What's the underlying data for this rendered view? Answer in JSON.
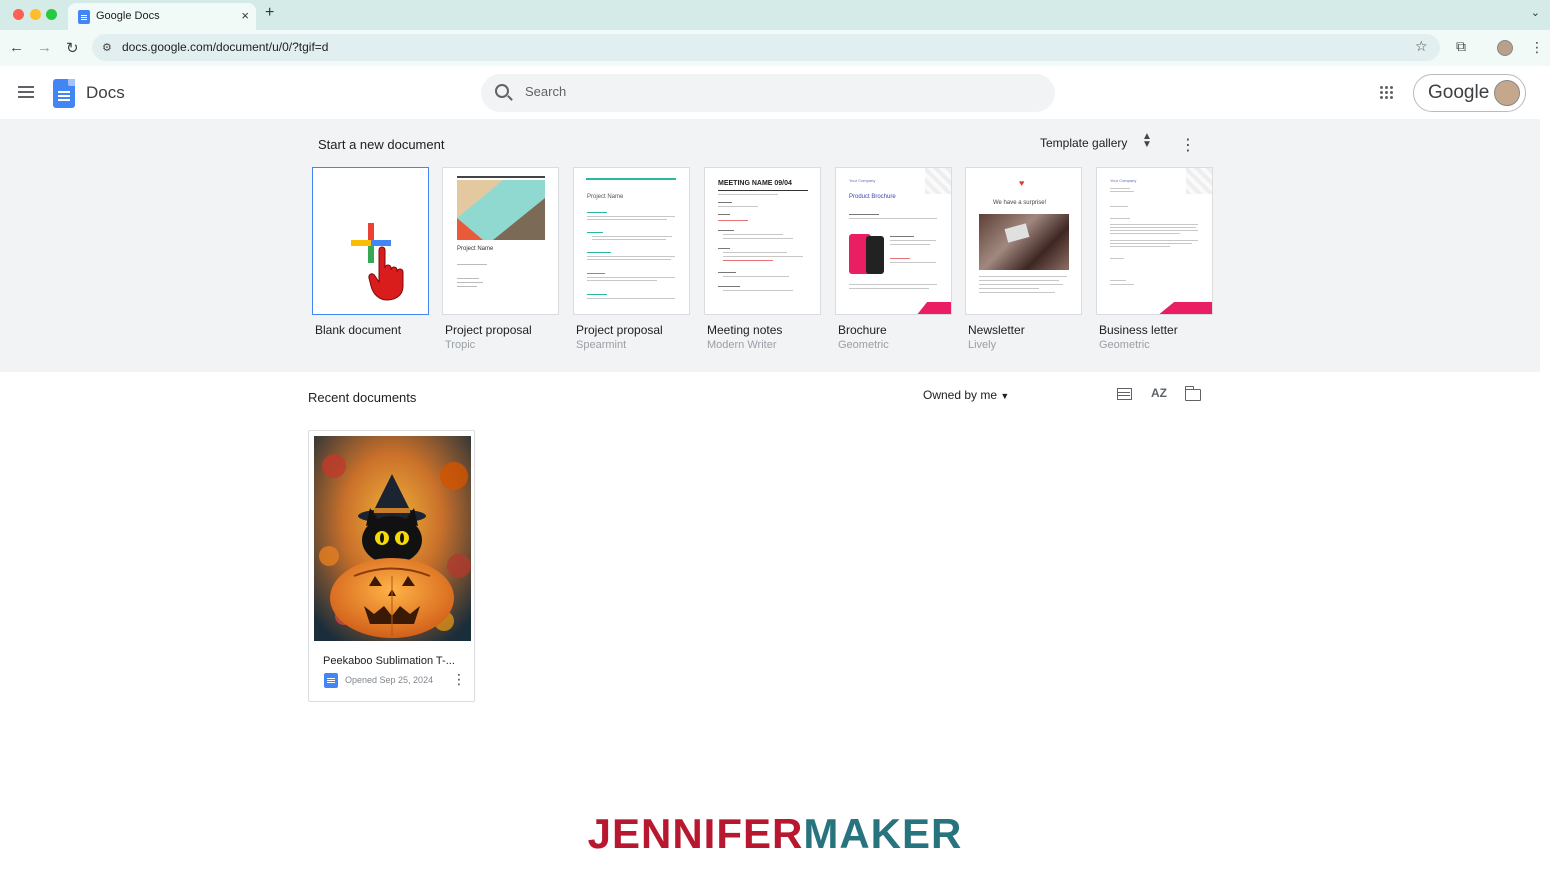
{
  "browser": {
    "tab_title": "Google Docs",
    "tab_close": "×",
    "new_tab": "+",
    "url": "docs.google.com/document/u/0/?tgif=d",
    "icons": [
      "back-icon",
      "forward-icon",
      "reload-icon",
      "site-settings-icon",
      "star-icon",
      "extensions-icon",
      "profile-icon",
      "menu-icon"
    ]
  },
  "header": {
    "app_name": "Docs",
    "search_placeholder": "Search",
    "account_brand": "Google"
  },
  "templates": {
    "section_title": "Start a new document",
    "gallery_label": "Template gallery",
    "items": [
      {
        "name": "Blank document",
        "sub": ""
      },
      {
        "name": "Project proposal",
        "sub": "Tropic"
      },
      {
        "name": "Project proposal",
        "sub": "Spearmint"
      },
      {
        "name": "Meeting notes",
        "sub": "Modern Writer"
      },
      {
        "name": "Brochure",
        "sub": "Geometric"
      },
      {
        "name": "Newsletter",
        "sub": "Lively"
      },
      {
        "name": "Business letter",
        "sub": "Geometric"
      }
    ],
    "thumb_text": {
      "tropic_title": "Project Name",
      "spearmint_title": "Project Name",
      "meeting_title": "MEETING NAME 09/04",
      "brochure_company": "Your Company",
      "brochure_title": "Product Brochure",
      "newsletter_title": "We have a surprise!",
      "letter_company": "Your Company"
    }
  },
  "recent": {
    "section_title": "Recent documents",
    "owner_filter": "Owned by me",
    "documents": [
      {
        "title": "Peekaboo Sublimation T-...",
        "opened": "Opened Sep 25, 2024"
      }
    ]
  },
  "watermark": {
    "part1": "JENNIFER",
    "part2": "MAKER"
  },
  "colors": {
    "accent_blue": "#4285f4",
    "template_bg": "#f1f3f4",
    "brand_red": "#b8182f",
    "brand_teal": "#27747e"
  }
}
